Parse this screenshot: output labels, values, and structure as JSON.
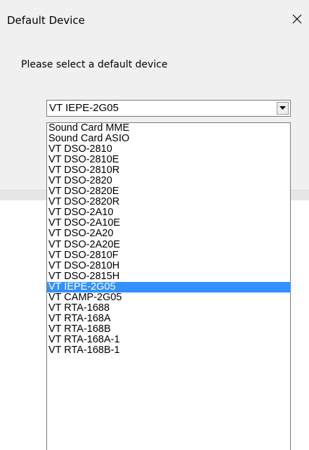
{
  "dialog": {
    "title": "Default Device",
    "prompt": "Please select a default device",
    "close_glyph": "✕",
    "close_icon": "close-icon"
  },
  "combo": {
    "selected": "VT IEPE-2G05",
    "arrow_icon": "chevron-down-icon"
  },
  "dropdown": {
    "selected_index": 15,
    "options": [
      "Sound Card MME",
      "Sound Card ASIO",
      "VT DSO-2810",
      "VT DSO-2810E",
      "VT DSO-2810R",
      "VT DSO-2820",
      "VT DSO-2820E",
      "VT DSO-2820R",
      "VT DSO-2A10",
      "VT DSO-2A10E",
      "VT DSO-2A20",
      "VT DSO-2A20E",
      "VT DSO-2810F",
      "VT DSO-2810H",
      "VT DSO-2815H",
      "VT IEPE-2G05",
      "VT CAMP-2G05",
      "VT RTA-1688",
      "VT RTA-168A",
      "VT RTA-168B",
      "VT RTA-168A-1",
      "VT RTA-168B-1"
    ]
  },
  "colors": {
    "selection": "#3391ff",
    "dialog_background": "#f0f0f0"
  }
}
